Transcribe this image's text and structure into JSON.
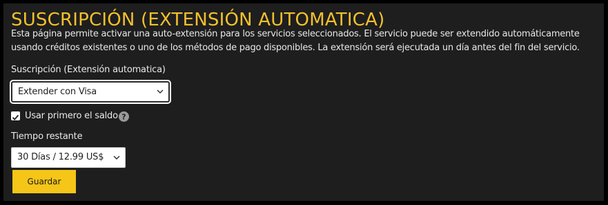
{
  "section": {
    "title": "SUSCRIPCIÓN (EXTENSIÓN AUTOMATICA)",
    "description": "Esta página permite activar una auto-extensión para los servicios seleccionados. El servicio puede ser extendido automáticamente usando créditos existentes o uno de los métodos de pago disponibles. La extensión será ejecutada un día antes del fin del servicio."
  },
  "subscription": {
    "label": "Suscripción (Extensión automatica)",
    "selected": "Extender con Visa"
  },
  "use_balance": {
    "label": "Usar primero el saldo",
    "checked": true
  },
  "remaining_time": {
    "label": "Tiempo restante",
    "selected": "30 Días / 12.99 US$"
  },
  "save_button": {
    "label": "Guardar"
  },
  "colors": {
    "background": "#1e1e1e",
    "accent": "#f2c02d",
    "button": "#f5c518",
    "text": "#e8e8e8"
  },
  "icons": {
    "dropdown": "chevron-down-icon",
    "checkbox": "checkmark-icon",
    "help": "question-mark-icon"
  }
}
